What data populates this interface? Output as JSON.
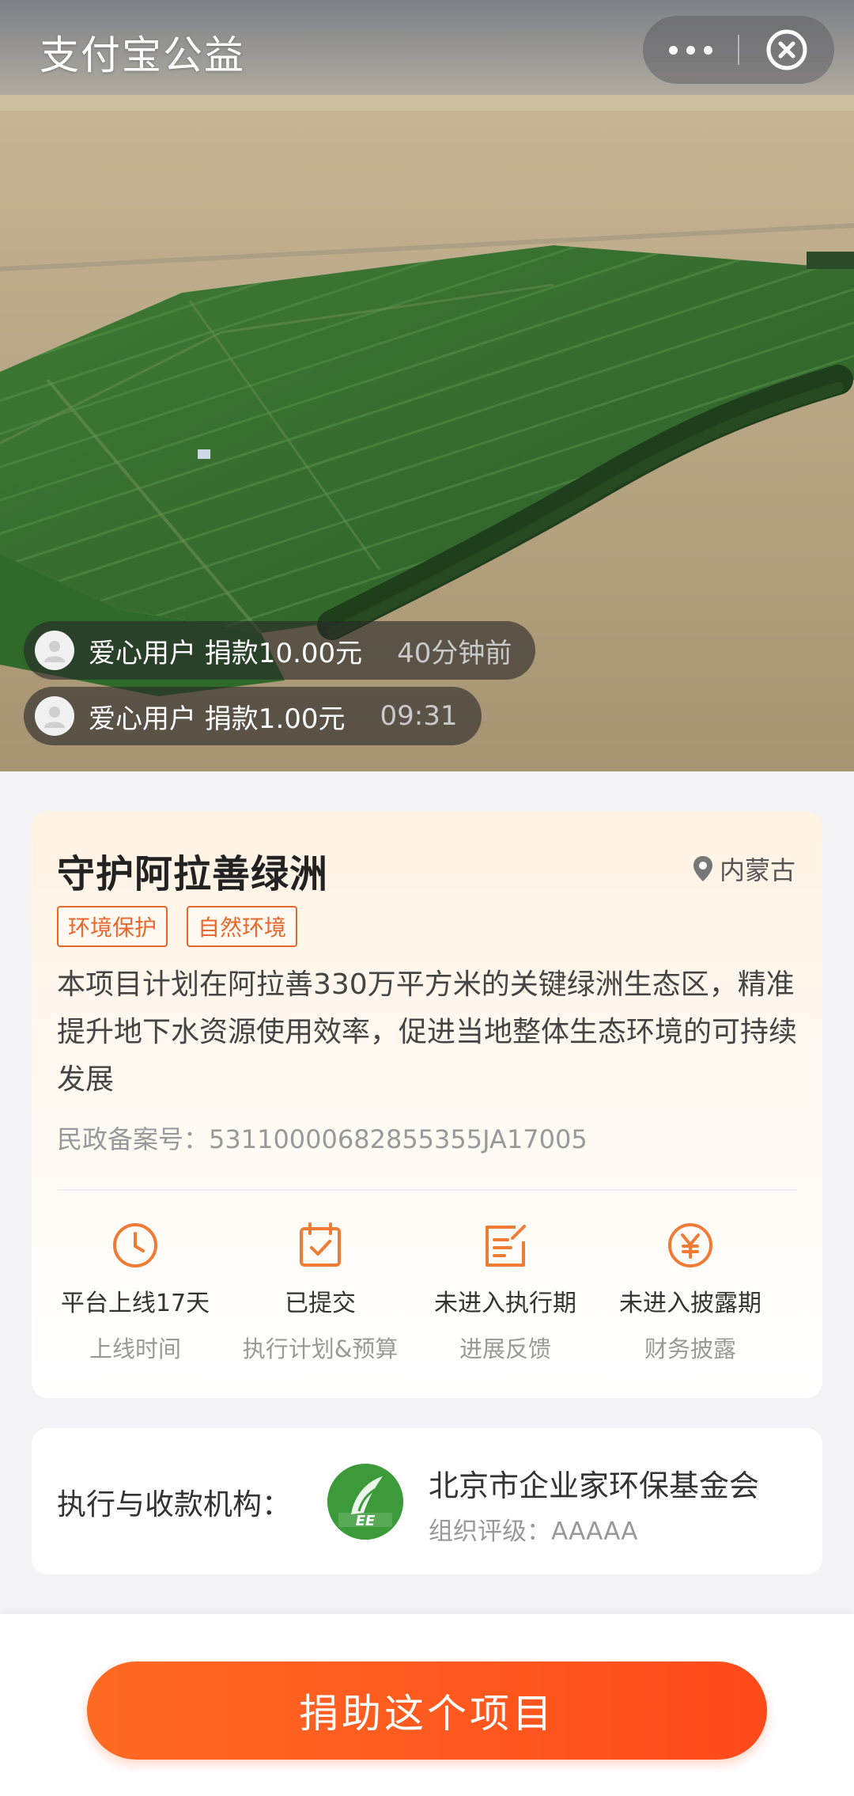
{
  "header": {
    "app_title": "支付宝公益",
    "more_icon": "more-dots-icon",
    "close_icon": "close-circle-icon"
  },
  "donations": [
    {
      "text": "爱心用户 捐款10.00元",
      "time": "40分钟前"
    },
    {
      "text": "爱心用户 捐款1.00元",
      "time": "09:31"
    }
  ],
  "project": {
    "title": "守护阿拉善绿洲",
    "location": "内蒙古",
    "tags": [
      "环境保护",
      "自然环境"
    ],
    "description": "本项目计划在阿拉善330万平方米的关键绿洲生态区，精准提升地下水资源使用效率，促进当地整体生态环境的可持续发展",
    "registration": "民政备案号：53110000682855355JA17005",
    "stats": [
      {
        "icon": "clock-icon",
        "value": "平台上线17天",
        "label": "上线时间"
      },
      {
        "icon": "calendar-check-icon",
        "value": "已提交",
        "label": "执行计划&预算"
      },
      {
        "icon": "edit-report-icon",
        "value": "未进入执行期",
        "label": "进展反馈"
      },
      {
        "icon": "yuan-coin-icon",
        "value": "未进入披露期",
        "label": "财务披露"
      }
    ]
  },
  "organization": {
    "label": "执行与收款机构：",
    "name": "北京市企业家环保基金会",
    "rating": "组织评级：AAAAA",
    "logo_text": "EE"
  },
  "action": {
    "donate_label": "捐助这个项目"
  },
  "colors": {
    "accent": "#e8672a",
    "button": "#ff5a1f"
  }
}
